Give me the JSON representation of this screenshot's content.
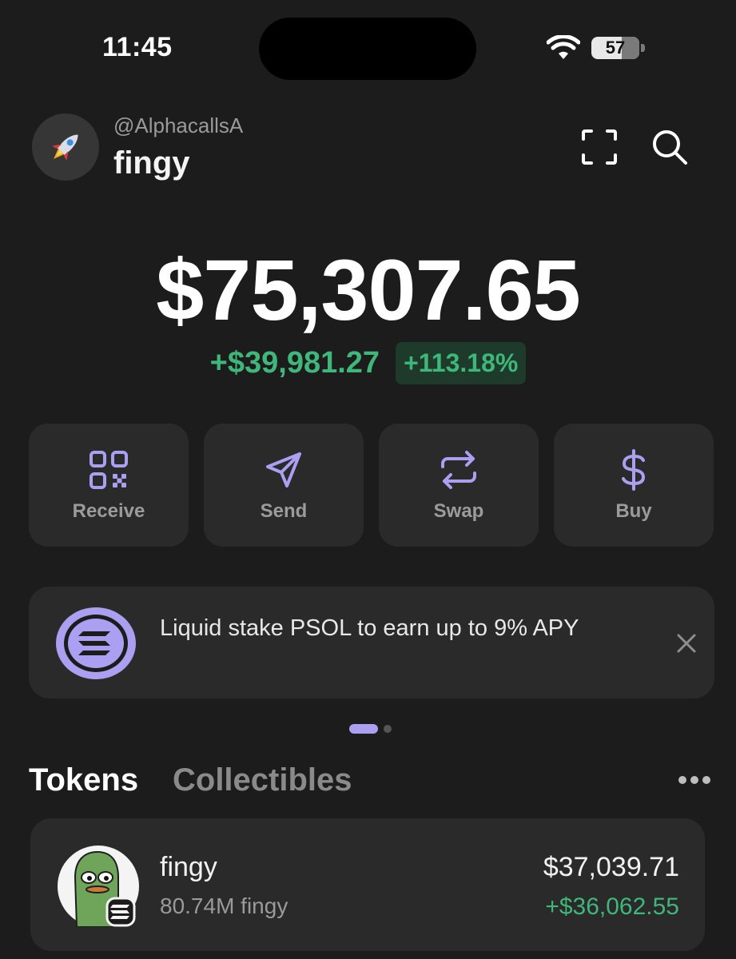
{
  "status_bar": {
    "time": "11:45",
    "battery": "57",
    "icons": [
      "wifi-icon",
      "battery-icon"
    ]
  },
  "header": {
    "handle": "@AlphacallsA",
    "wallet_name": "fingy",
    "avatar_icon": "rocket-icon",
    "icons": [
      "scan-icon",
      "search-icon"
    ]
  },
  "balance": {
    "total": "$75,307.65",
    "change_amount": "+$39,981.27",
    "change_percent": "+113.18%"
  },
  "actions": [
    {
      "label": "Receive",
      "icon": "qr-code-icon"
    },
    {
      "label": "Send",
      "icon": "send-icon"
    },
    {
      "label": "Swap",
      "icon": "swap-icon"
    },
    {
      "label": "Buy",
      "icon": "dollar-icon"
    }
  ],
  "promo": {
    "text": "Liquid stake PSOL to earn up to 9% APY",
    "icon": "solana-icon",
    "close_icon": "close-icon"
  },
  "pager": {
    "count": 2,
    "active": 0
  },
  "tabs": [
    {
      "label": "Tokens",
      "active": true
    },
    {
      "label": "Collectibles",
      "active": false
    }
  ],
  "tokens": [
    {
      "name": "fingy",
      "amount": "80.74M fingy",
      "value": "$37,039.71",
      "change": "+$36,062.55"
    }
  ],
  "colors": {
    "background": "#1c1c1c",
    "card": "#2a2a2a",
    "accent": "#ab9ff2",
    "positive": "#3fb77a"
  }
}
